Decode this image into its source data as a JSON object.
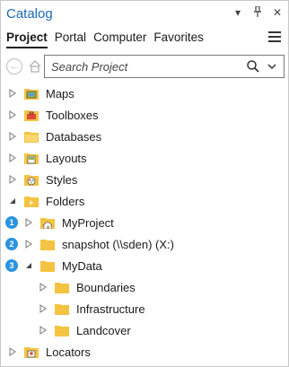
{
  "window": {
    "title": "Catalog"
  },
  "tabs": [
    {
      "label": "Project",
      "active": true
    },
    {
      "label": "Portal",
      "active": false
    },
    {
      "label": "Computer",
      "active": false
    },
    {
      "label": "Favorites",
      "active": false
    }
  ],
  "search": {
    "placeholder": "Search Project"
  },
  "colors": {
    "accent": "#1a6ab5",
    "badge": "#2b94e0",
    "folder": "#f5c342"
  },
  "tree": [
    {
      "label": "Maps",
      "icon": "map-icon"
    },
    {
      "label": "Toolboxes",
      "icon": "toolbox-icon"
    },
    {
      "label": "Databases",
      "icon": "database-folder-icon"
    },
    {
      "label": "Layouts",
      "icon": "layout-icon"
    },
    {
      "label": "Styles",
      "icon": "style-icon"
    },
    {
      "label": "Folders",
      "icon": "folder-icon"
    },
    {
      "label": "MyProject",
      "icon": "home-folder-icon",
      "badge": "1"
    },
    {
      "label": "snapshot (\\\\sden) (X:)",
      "icon": "folder-icon",
      "badge": "2"
    },
    {
      "label": "MyData",
      "icon": "folder-icon",
      "badge": "3"
    },
    {
      "label": "Boundaries",
      "icon": "folder-icon"
    },
    {
      "label": "Infrastructure",
      "icon": "folder-icon"
    },
    {
      "label": "Landcover",
      "icon": "folder-icon"
    },
    {
      "label": "Locators",
      "icon": "locator-icon"
    }
  ]
}
